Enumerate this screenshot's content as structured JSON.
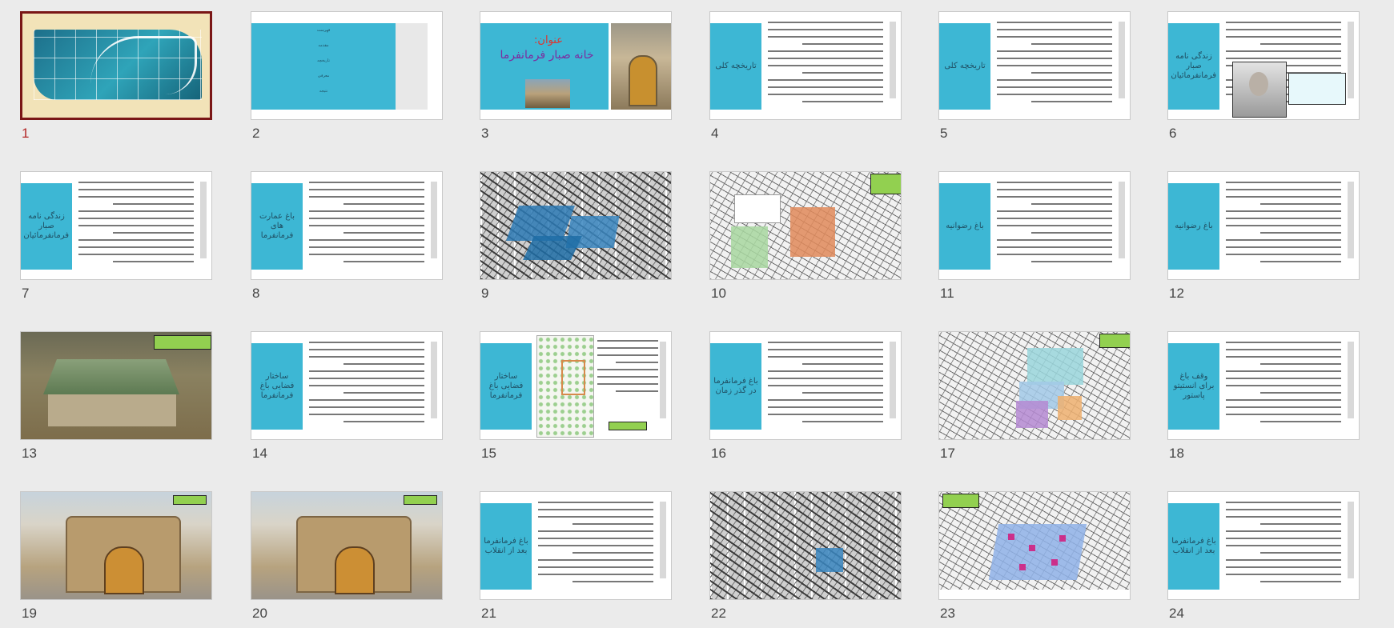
{
  "slides": [
    {
      "number": "1",
      "kind": "calligraphy",
      "selected": true
    },
    {
      "number": "2",
      "kind": "contents",
      "items": [
        "فهرست",
        "مقدمه",
        "تاریخچه",
        "معرفی",
        "نتیجه"
      ]
    },
    {
      "number": "3",
      "kind": "title",
      "heading": "عنوان:",
      "title": "خانه صبار فرمانفرما"
    },
    {
      "number": "4",
      "kind": "text",
      "panel_title": "تاریخچه کلی"
    },
    {
      "number": "5",
      "kind": "text",
      "panel_title": "تاریخچه کلی"
    },
    {
      "number": "6",
      "kind": "text",
      "panel_title": "زندگی نامه صبار فرمانفرمائیان"
    },
    {
      "number": "7",
      "kind": "text",
      "panel_title": "زندگی نامه صبار فرمانفرمائیان"
    },
    {
      "number": "8",
      "kind": "text",
      "panel_title": "باغ عمارت های فرمانفرما"
    },
    {
      "number": "9",
      "kind": "map",
      "blobs": "blue"
    },
    {
      "number": "10",
      "kind": "map",
      "blobs": "green-orange"
    },
    {
      "number": "11",
      "kind": "text",
      "panel_title": "باغ رضوانیه"
    },
    {
      "number": "12",
      "kind": "text",
      "panel_title": "باغ رضوانیه"
    },
    {
      "number": "13",
      "kind": "photo-house"
    },
    {
      "number": "14",
      "kind": "text",
      "panel_title": "ساختار فضایی باغ فرمانفرما"
    },
    {
      "number": "15",
      "kind": "plan",
      "panel_title": "ساختار فضایی باغ فرمانفرما"
    },
    {
      "number": "16",
      "kind": "text",
      "panel_title": "باغ فرمانفرما در گذر زمان"
    },
    {
      "number": "17",
      "kind": "map",
      "blobs": "multi"
    },
    {
      "number": "18",
      "kind": "text",
      "panel_title": "وقف باغ برای انستیتو پاستور"
    },
    {
      "number": "19",
      "kind": "photo-gate"
    },
    {
      "number": "20",
      "kind": "photo-gate"
    },
    {
      "number": "21",
      "kind": "text",
      "panel_title": "باغ فرمانفرما بعد از انقلاب"
    },
    {
      "number": "22",
      "kind": "map",
      "blobs": "blue-small"
    },
    {
      "number": "23",
      "kind": "map",
      "blobs": "pink-blue"
    },
    {
      "number": "24",
      "kind": "text",
      "panel_title": "باغ فرمانفرما بعد از انقلاب"
    }
  ],
  "colors": {
    "accent": "#3db7d4",
    "selection": "#7a1616",
    "tag": "#92d050"
  }
}
